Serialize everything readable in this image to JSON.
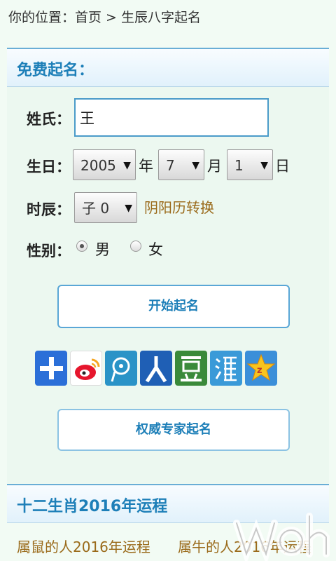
{
  "breadcrumb": {
    "prefix": "你的位置：",
    "home": "首页",
    "separator": ">",
    "current": "生辰八字起名"
  },
  "free_naming": {
    "header": "免费起名：",
    "surname": {
      "label": "姓氏：",
      "value": "王"
    },
    "birthday": {
      "label": "生日：",
      "year": "2005",
      "year_unit": "年",
      "month": "7",
      "month_unit": "月",
      "day": "1",
      "day_unit": "日"
    },
    "hour": {
      "label": "时辰：",
      "value": "子 0",
      "convert_link": "阴阳历转换"
    },
    "gender": {
      "label": "性别：",
      "male": "男",
      "female": "女",
      "selected": "male"
    },
    "start_button": "开始起名",
    "share_icons": [
      "qzone-plus-icon",
      "weibo-icon",
      "tencent-weibo-icon",
      "renren-icon",
      "douban-icon",
      "kaixin-icon",
      "qzone-star-icon"
    ],
    "expert_button": "权威专家起名"
  },
  "zodiac": {
    "header": "十二生肖2016年运程",
    "links": [
      "属鼠的人2016年运程",
      "属牛的人2016年运程"
    ]
  },
  "colors": {
    "accent": "#1d7fb8",
    "link": "#9a6a1a",
    "background": "#f2fbf4"
  }
}
